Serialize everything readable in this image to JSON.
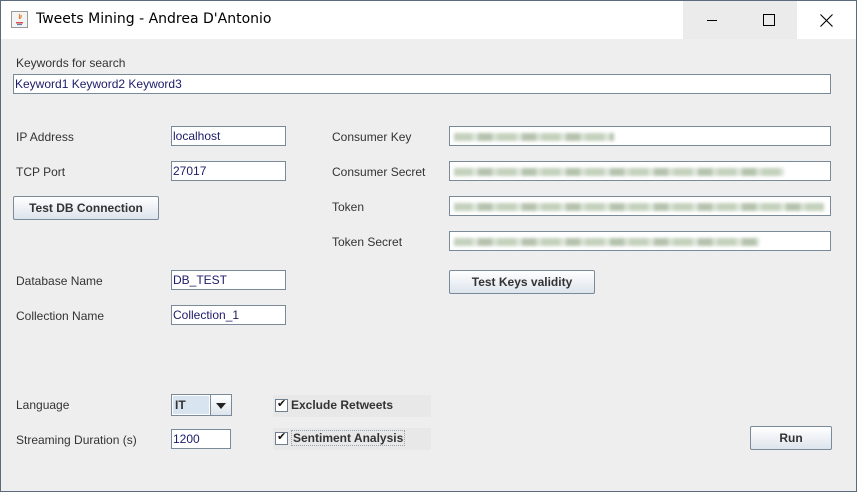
{
  "window": {
    "title": "Tweets Mining - Andrea D'Antonio"
  },
  "search": {
    "label": "Keywords for search",
    "value": "Keyword1 Keyword2 Keyword3"
  },
  "db": {
    "ip_label": "IP Address",
    "ip_value": "localhost",
    "port_label": "TCP Port",
    "port_value": "27017",
    "test_button": "Test DB Connection",
    "dbname_label": "Database Name",
    "dbname_value": "DB_TEST",
    "collection_label": "Collection Name",
    "collection_value": "Collection_1"
  },
  "keys": {
    "consumer_key_label": "Consumer Key",
    "consumer_secret_label": "Consumer Secret",
    "token_label": "Token",
    "token_secret_label": "Token Secret",
    "test_button": "Test Keys validity"
  },
  "options": {
    "language_label": "Language",
    "language_value": "IT",
    "duration_label": "Streaming Duration (s)",
    "duration_value": "1200",
    "exclude_retweets_label": "Exclude Retweets",
    "exclude_retweets_checked": true,
    "sentiment_label": "Sentiment Analysis",
    "sentiment_checked": true,
    "run_button": "Run"
  }
}
